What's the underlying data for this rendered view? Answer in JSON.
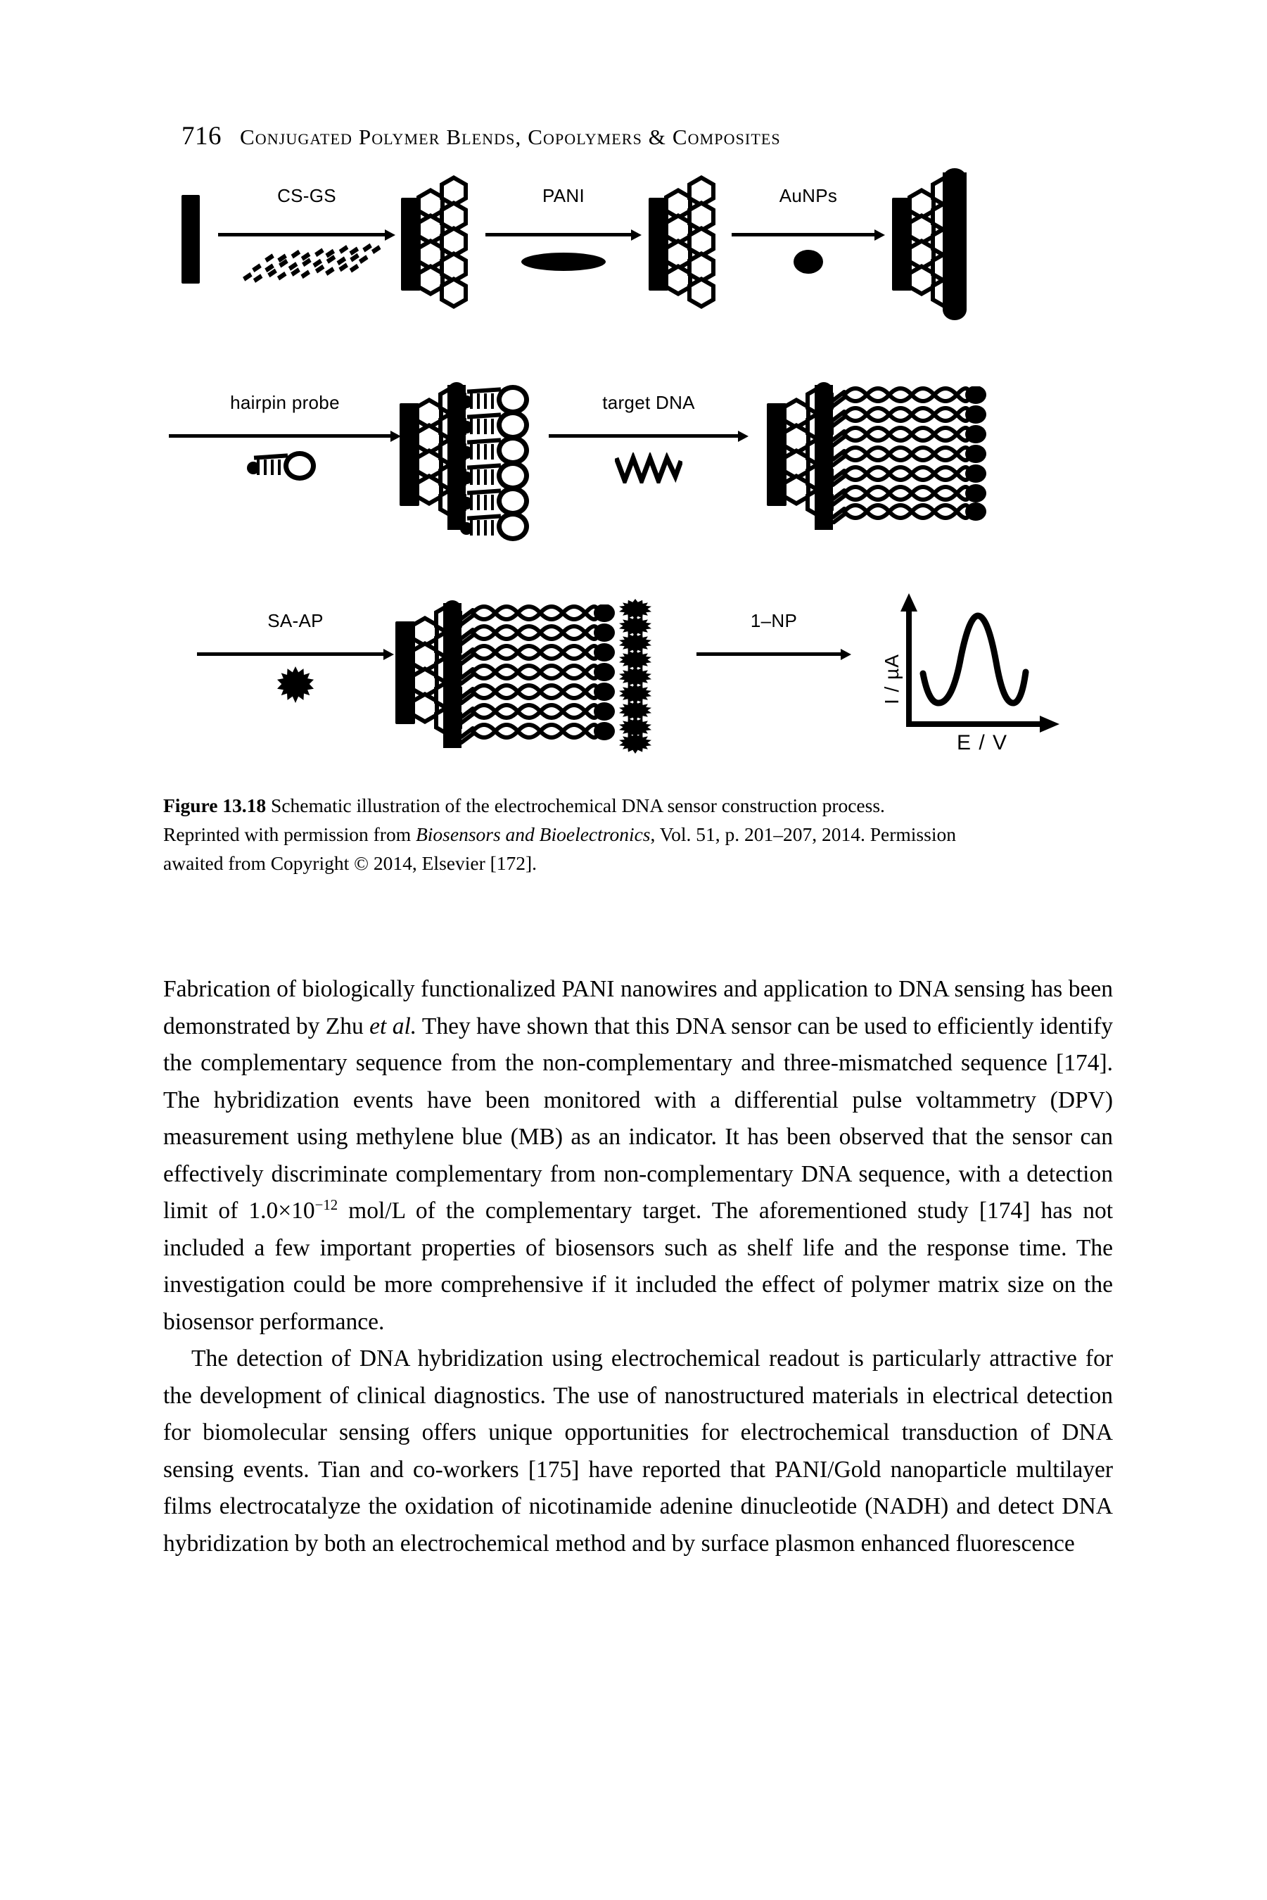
{
  "header": {
    "folio": "716",
    "title": "Conjugated Polymer Blends, Copolymers & Composites"
  },
  "figure": {
    "row1": {
      "steps": [
        {
          "label": "CS-GS",
          "icon": "graphene-sheet-speckled"
        },
        {
          "label": "PANI",
          "icon": "ellipse-blob"
        },
        {
          "label": "AuNPs",
          "icon": "filled-circle"
        }
      ]
    },
    "row2": {
      "steps": [
        {
          "label": "hairpin probe",
          "icon": "hairpin-loop"
        },
        {
          "label": "target DNA",
          "icon": "zigzag-strand"
        }
      ]
    },
    "row3": {
      "steps": [
        {
          "label": "SA-AP",
          "icon": "starburst"
        },
        {
          "label": "1–NP",
          "icon": "none"
        }
      ],
      "plot": {
        "ylabel": "I / µA",
        "xlabel": "E / V"
      }
    }
  },
  "caption": {
    "number": "Figure 13.18",
    "line1_a": "Schematic illustration of the electrochemical DNA sensor construction",
    "line2_a": "process. Reprinted with permission from ",
    "line2_italic": "Biosensors and Bioelectronics",
    "line2_b": ", Vol. 51,",
    "line3": "p. 201–207, 2014. Permission awaited from Copyright © 2014, Elsevier [172]."
  },
  "body": {
    "para1_part1": "Fabrication of biologically functionalized PANI nanowires and application to DNA sensing has been demonstrated by Zhu ",
    "para1_italic": "et al.",
    "para1_part2": " They have shown that this DNA sensor can be used to efficiently identify the complementary sequence from the non-complementary and three-mismatched sequence [174]. The hybridization events have been monitored with a differential pulse voltammetry (DPV) measurement using methylene blue (MB) as an indicator. It has been observed that the sensor can effectively discriminate complementary from non-complementary DNA sequence, with a detection limit of 1.0×10",
    "para1_sup": "−12",
    "para1_part3": " mol/L of the complementary target. The aforementioned study [174] has not included a few important properties of biosensors such as shelf life and the response time. The investigation could be more comprehensive if it included the effect of polymer matrix size on the biosensor performance.",
    "para2": "The detection of DNA hybridization using electrochemical readout is particularly attractive for the development of clinical diagnostics. The use of nanostructured materials in electrical detection for biomolecular sensing offers unique opportunities for electrochemical transduction of DNA sensing events. Tian and co-workers [175] have reported that PANI/Gold nanoparticle multilayer films electrocatalyze the oxidation of nicotinamide adenine dinucleotide (NADH) and detect DNA hybridization by both an electrochemical method and by surface plasmon enhanced fluorescence"
  }
}
